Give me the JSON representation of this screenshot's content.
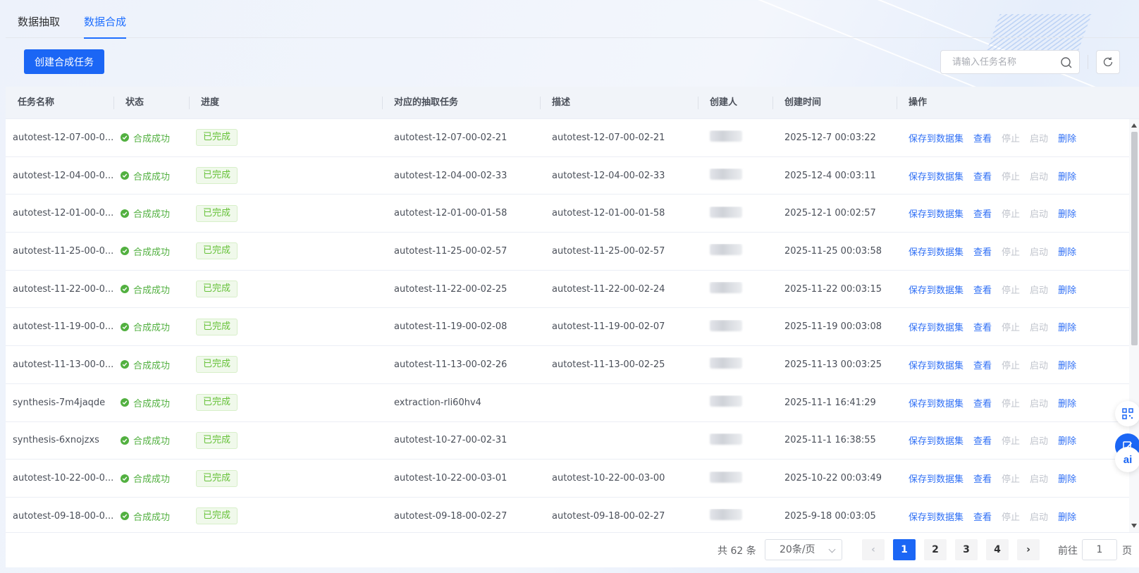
{
  "tabs": [
    {
      "label": "数据抽取",
      "active": false
    },
    {
      "label": "数据合成",
      "active": true
    }
  ],
  "toolbar": {
    "create_label": "创建合成任务",
    "search_placeholder": "请输入任务名称"
  },
  "table": {
    "columns": [
      "任务名称",
      "状态",
      "进度",
      "对应的抽取任务",
      "描述",
      "创建人",
      "创建时间",
      "操作"
    ],
    "actions": [
      "保存到数据集",
      "查看",
      "停止",
      "启动",
      "删除"
    ],
    "rows": [
      {
        "name": "autotest-12-07-00-0...",
        "status": "合成成功",
        "progress": "已完成",
        "extract": "autotest-12-07-00-02-21",
        "desc": "autotest-12-07-00-02-21",
        "creator": "",
        "time": "2025-12-7 00:03:22"
      },
      {
        "name": "autotest-12-04-00-0...",
        "status": "合成成功",
        "progress": "已完成",
        "extract": "autotest-12-04-00-02-33",
        "desc": "autotest-12-04-00-02-33",
        "creator": "",
        "time": "2025-12-4 00:03:11"
      },
      {
        "name": "autotest-12-01-00-0...",
        "status": "合成成功",
        "progress": "已完成",
        "extract": "autotest-12-01-00-01-58",
        "desc": "autotest-12-01-00-01-58",
        "creator": "",
        "time": "2025-12-1 00:02:57"
      },
      {
        "name": "autotest-11-25-00-0...",
        "status": "合成成功",
        "progress": "已完成",
        "extract": "autotest-11-25-00-02-57",
        "desc": "autotest-11-25-00-02-57",
        "creator": "",
        "time": "2025-11-25 00:03:58"
      },
      {
        "name": "autotest-11-22-00-0...",
        "status": "合成成功",
        "progress": "已完成",
        "extract": "autotest-11-22-00-02-25",
        "desc": "autotest-11-22-00-02-24",
        "creator": "",
        "time": "2025-11-22 00:03:15"
      },
      {
        "name": "autotest-11-19-00-0...",
        "status": "合成成功",
        "progress": "已完成",
        "extract": "autotest-11-19-00-02-08",
        "desc": "autotest-11-19-00-02-07",
        "creator": "",
        "time": "2025-11-19 00:03:08"
      },
      {
        "name": "autotest-11-13-00-0...",
        "status": "合成成功",
        "progress": "已完成",
        "extract": "autotest-11-13-00-02-26",
        "desc": "autotest-11-13-00-02-25",
        "creator": "",
        "time": "2025-11-13 00:03:25"
      },
      {
        "name": "synthesis-7m4jaqde",
        "status": "合成成功",
        "progress": "已完成",
        "extract": "extraction-rli60hv4",
        "desc": "",
        "creator": "",
        "time": "2025-11-1 16:41:29"
      },
      {
        "name": "synthesis-6xnojzxs",
        "status": "合成成功",
        "progress": "已完成",
        "extract": "autotest-10-27-00-02-31",
        "desc": "",
        "creator": "",
        "time": "2025-11-1 16:38:55"
      },
      {
        "name": "autotest-10-22-00-0...",
        "status": "合成成功",
        "progress": "已完成",
        "extract": "autotest-10-22-00-03-01",
        "desc": "autotest-10-22-00-03-00",
        "creator": "",
        "time": "2025-10-22 00:03:49"
      },
      {
        "name": "autotest-09-18-00-0...",
        "status": "合成成功",
        "progress": "已完成",
        "extract": "autotest-09-18-00-02-27",
        "desc": "autotest-09-18-00-02-27",
        "creator": "",
        "time": "2025-9-18 00:03:05"
      }
    ]
  },
  "pagination": {
    "total_label": "共 62 条",
    "page_size": "20条/页",
    "pages": [
      "1",
      "2",
      "3",
      "4"
    ],
    "current": "1",
    "goto_prefix": "前往",
    "goto_value": "1",
    "goto_suffix": "页"
  },
  "float_buttons": [
    "qr-code-icon",
    "edit-icon",
    "ai-icon"
  ],
  "colors": {
    "accent": "#1b66f5",
    "success": "#52b040",
    "link": "#2f6ff5",
    "disabled": "#c0c4cc"
  }
}
